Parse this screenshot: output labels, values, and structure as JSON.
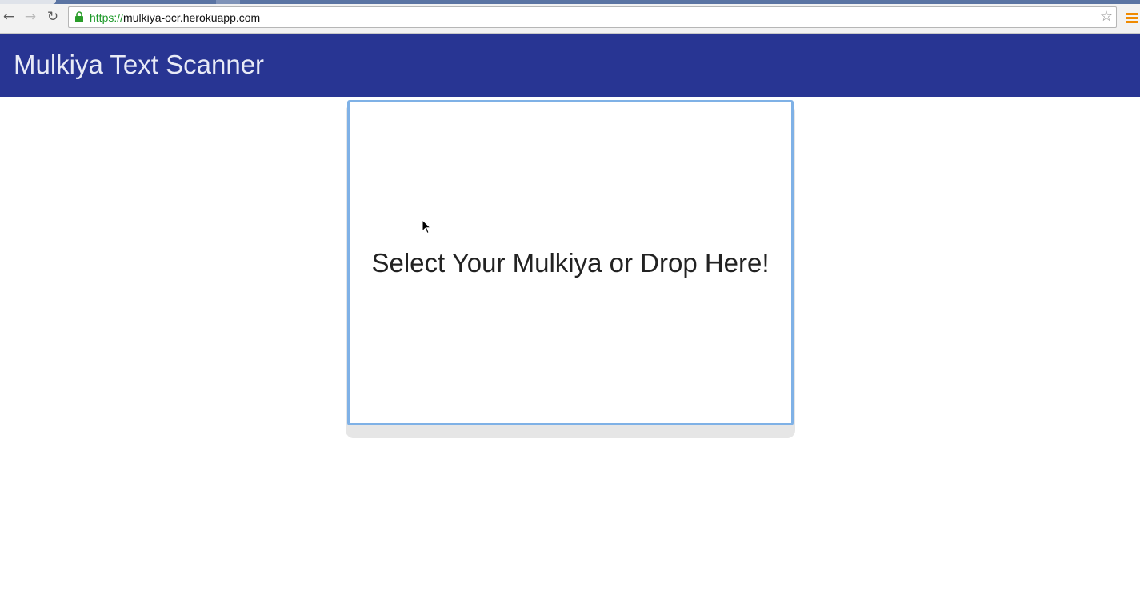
{
  "browser": {
    "url_scheme": "https://",
    "url_host": "mulkiya-ocr.herokuapp.com",
    "icons": {
      "back": "back-arrow-icon",
      "forward": "forward-arrow-icon",
      "reload": "reload-icon",
      "lock": "lock-icon",
      "bookmark": "star-icon",
      "menu": "hamburger-menu-icon"
    }
  },
  "header": {
    "title": "Mulkiya Text Scanner",
    "background_color": "#283593"
  },
  "upload": {
    "prompt": "Select Your Mulkiya or Drop Here!",
    "border_color": "#7fb1e6"
  }
}
